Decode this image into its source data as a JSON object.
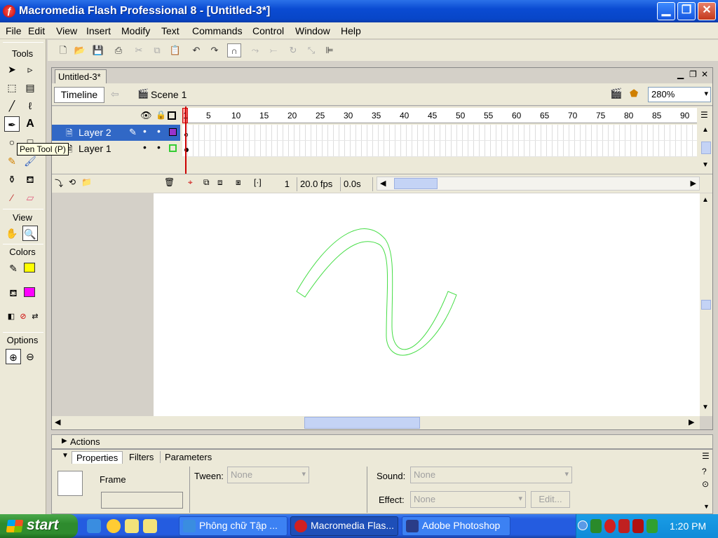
{
  "window": {
    "title": "Macromedia Flash Professional 8 - [Untitled-3*]",
    "app_icon": "flash-logo-icon",
    "controls": {
      "minimize": "_",
      "maximize": "❐",
      "close": "✕"
    }
  },
  "menu": [
    "File",
    "Edit",
    "View",
    "Insert",
    "Modify",
    "Text",
    "Commands",
    "Control",
    "Window",
    "Help"
  ],
  "tools": {
    "header": "Tools",
    "tooltip": "Pen Tool (P)",
    "view_header": "View",
    "colors_header": "Colors",
    "options_header": "Options",
    "stroke_color": "#ffff00",
    "fill_color": "#ff00ff"
  },
  "document": {
    "tab_label": "Untitled-3*",
    "timeline_button": "Timeline",
    "scene_label": "Scene 1",
    "zoom": "280%"
  },
  "timeline": {
    "frame_numbers": [
      "1",
      "5",
      "10",
      "15",
      "20",
      "25",
      "30",
      "35",
      "40",
      "45",
      "50",
      "55",
      "60",
      "65",
      "70",
      "75",
      "80",
      "85",
      "90"
    ],
    "layers": [
      {
        "name": "Layer 2",
        "selected": true,
        "outline_color": "#9933cc"
      },
      {
        "name": "Layer 1",
        "selected": false,
        "outline_color": "#33cc33"
      }
    ],
    "current_frame": "1",
    "frame_rate": "20.0 fps",
    "elapsed_time": "0.0s"
  },
  "stage": {
    "shape_stroke_color": "#44dd44"
  },
  "panels": {
    "actions_label": "Actions",
    "tabs": [
      "Properties",
      "Filters",
      "Parameters"
    ],
    "frame_label": "Frame",
    "tween_label": "Tween:",
    "tween_value": "None",
    "sound_label": "Sound:",
    "sound_value": "None",
    "effect_label": "Effect:",
    "effect_value": "None",
    "edit_button": "Edit..."
  },
  "taskbar": {
    "start_label": "start",
    "tasks": [
      {
        "label": "Phông chữ Tập ...",
        "icon": "ie-icon",
        "active": false
      },
      {
        "label": "Macromedia Flas...",
        "icon": "flash-icon",
        "active": true
      },
      {
        "label": "Adobe Photoshop",
        "icon": "photoshop-icon",
        "active": false
      }
    ],
    "clock": "1:20 PM"
  }
}
